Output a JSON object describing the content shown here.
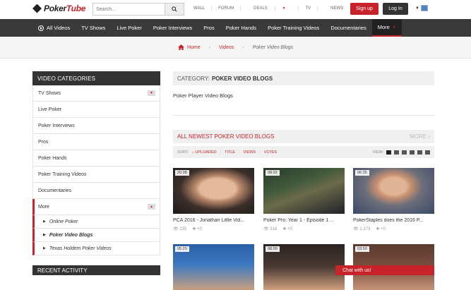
{
  "header": {
    "logo_text_left": "Poker",
    "logo_text_right": "Tube",
    "search_placeholder": "Search...",
    "links": [
      "WALL",
      "FORUM",
      "DEALS",
      "TV",
      "NEWS"
    ],
    "signup_label": "Sign up",
    "login_label": "Log In"
  },
  "nav": {
    "items": [
      "All Videos",
      "TV Shows",
      "Live Poker",
      "Poker Interviews",
      "Pros",
      "Poker Hands",
      "Poker Training Videos",
      "Documentaries",
      "More"
    ]
  },
  "breadcrumb": {
    "home": "Home",
    "videos": "Videos",
    "current": "Poker Video Blogs"
  },
  "sidebar": {
    "title": "VIDEO CATEGORIES",
    "items": [
      "TV Shows",
      "Live Poker",
      "Poker Interviews",
      "Pros",
      "Poker Hands",
      "Poker Training Videos",
      "Documentaries",
      "More"
    ],
    "sub_items": [
      "Online Poker",
      "Poker Video Blogs",
      "Texas Holdem Poker Videos"
    ],
    "recent_title": "RECENT ACTIVITY"
  },
  "main": {
    "category_prefix": "CATEGORY:",
    "category_name": "POKER VIDEO BLOGS",
    "subtitle": "Poker Player Video Blogs",
    "newest_title": "ALL NEWEST POKER VIDEO BLOGS",
    "more_label": "MORE",
    "sort_label": "SORT:",
    "sort_options": [
      "UPLOADED",
      "TITLE",
      "VIEWS",
      "VOTES"
    ],
    "view_label": "VIEW:"
  },
  "videos": [
    {
      "duration": "20:38",
      "title": "PCA 2016 - Jonathan Little Vid...",
      "views": "135",
      "votes": "+0"
    },
    {
      "duration": "08:32",
      "title": "Poker Pro: Year 1 - Episode 1 ...",
      "views": "316",
      "votes": "+0"
    },
    {
      "duration": "06:35",
      "title": "PokerStaples does the 2016 P...",
      "views": "1,373",
      "votes": "+0"
    },
    {
      "duration": "05:29",
      "title": "",
      "views": "",
      "votes": ""
    },
    {
      "duration": "08:09",
      "title": "",
      "views": "",
      "votes": ""
    },
    {
      "duration": "03:50",
      "title": "",
      "views": "",
      "votes": ""
    }
  ],
  "chat": {
    "label": "Chat with us!"
  },
  "colors": {
    "accent": "#c8232a",
    "nav_bg": "#3a3a3a",
    "sidebar_head": "#333333"
  }
}
